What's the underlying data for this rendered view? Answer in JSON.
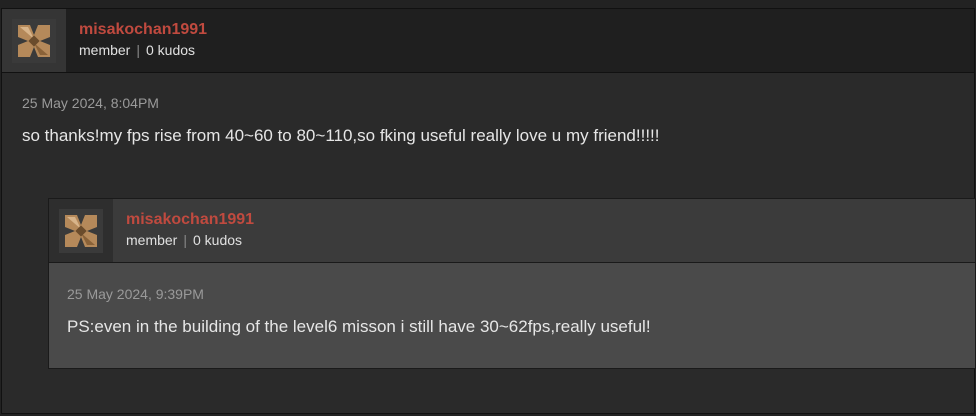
{
  "post": {
    "username": "misakochan1991",
    "role": "member",
    "separator": "|",
    "kudos": "0 kudos",
    "date": "25 May 2024, 8:04PM",
    "message": "so thanks!my fps rise from 40~60 to 80~110,so fking useful really love u my friend!!!!!"
  },
  "reply": {
    "username": "misakochan1991",
    "role": "member",
    "separator": "|",
    "kudos": "0 kudos",
    "date": "25 May 2024, 9:39PM",
    "message": "PS:even in the building of the level6 misson i still have 30~62fps,really useful!"
  },
  "colors": {
    "username": "#c04a3f",
    "background": "#2a2a2a",
    "reply_background": "#4a4a4a"
  },
  "icons": {
    "avatar": "avatar-icon"
  }
}
